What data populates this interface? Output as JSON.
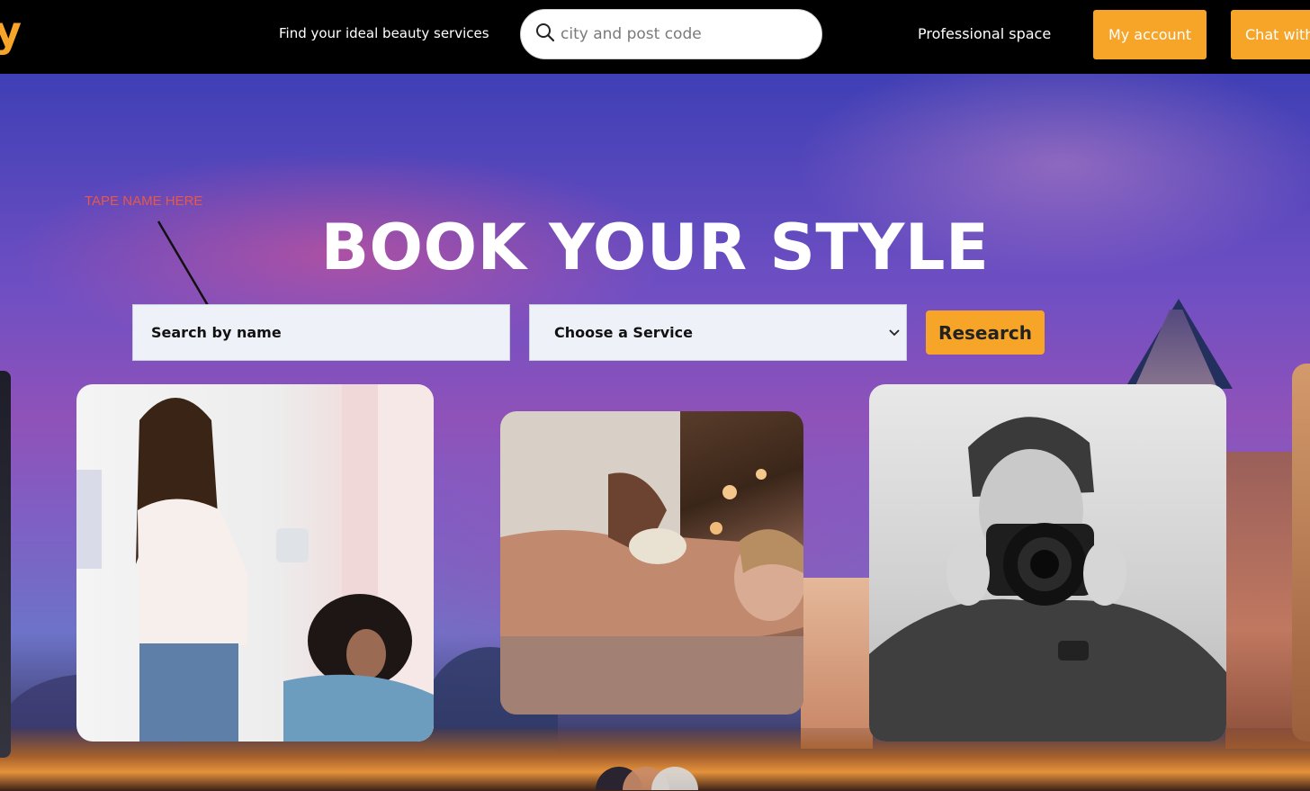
{
  "header": {
    "logo_fragment": "y",
    "tagline": "Find your ideal beauty services",
    "location_search": {
      "placeholder": "city and post code"
    },
    "professional_link": "Professional space",
    "my_account_button": "My account",
    "chat_button": "Chat with"
  },
  "hero": {
    "annotation": "TAPE NAME HERE",
    "title": "BOOK YOUR STYLE",
    "search_name_placeholder": "Search by name",
    "service_select_label": "Choose a Service",
    "research_button": "Research"
  },
  "cards": [
    {
      "name": "hairdresser",
      "icon": "hair-stylist-photo"
    },
    {
      "name": "massage",
      "icon": "massage-photo"
    },
    {
      "name": "photographer",
      "icon": "photographer-photo"
    }
  ],
  "colors": {
    "accent": "#f7a529",
    "annotation": "#e5584a",
    "topbar": "#000000"
  }
}
